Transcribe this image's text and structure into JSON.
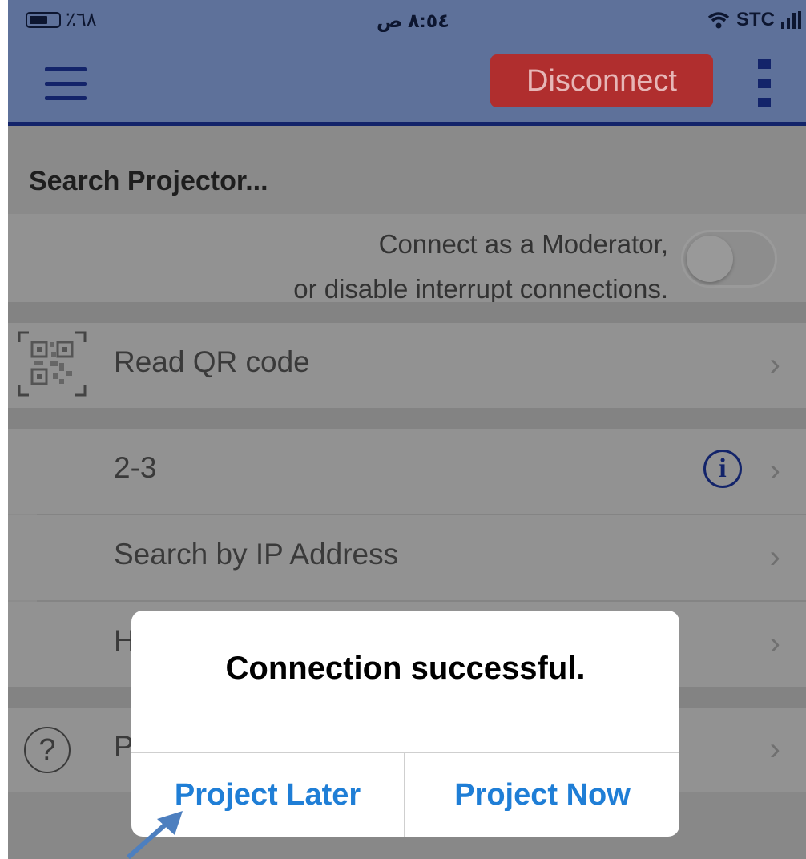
{
  "status_bar": {
    "battery_percent": "٪٦٨",
    "time": "٨:٥٤ ص",
    "carrier": "STC"
  },
  "nav": {
    "disconnect_label": "Disconnect",
    "colors": {
      "bar": "#5e719a",
      "accent": "#13246a",
      "disconnect": "#b02e2e"
    }
  },
  "search": {
    "title": "Search Projector...",
    "moderator_line1": "Connect as a Moderator,",
    "moderator_line2": "or disable interrupt connections.",
    "moderator_toggle_on": false
  },
  "list": {
    "qr_label": "Read QR code",
    "projector_name": "2-3",
    "ip_search_label": "Search by IP Address",
    "hidden_row_label": "H",
    "help_row_label": "P"
  },
  "dialog": {
    "message": "Connection successful.",
    "later_label": "Project Later",
    "now_label": "Project Now",
    "button_color": "#1f7ed6"
  },
  "icons": {
    "info": "i",
    "help": "?",
    "chevron": "›"
  }
}
